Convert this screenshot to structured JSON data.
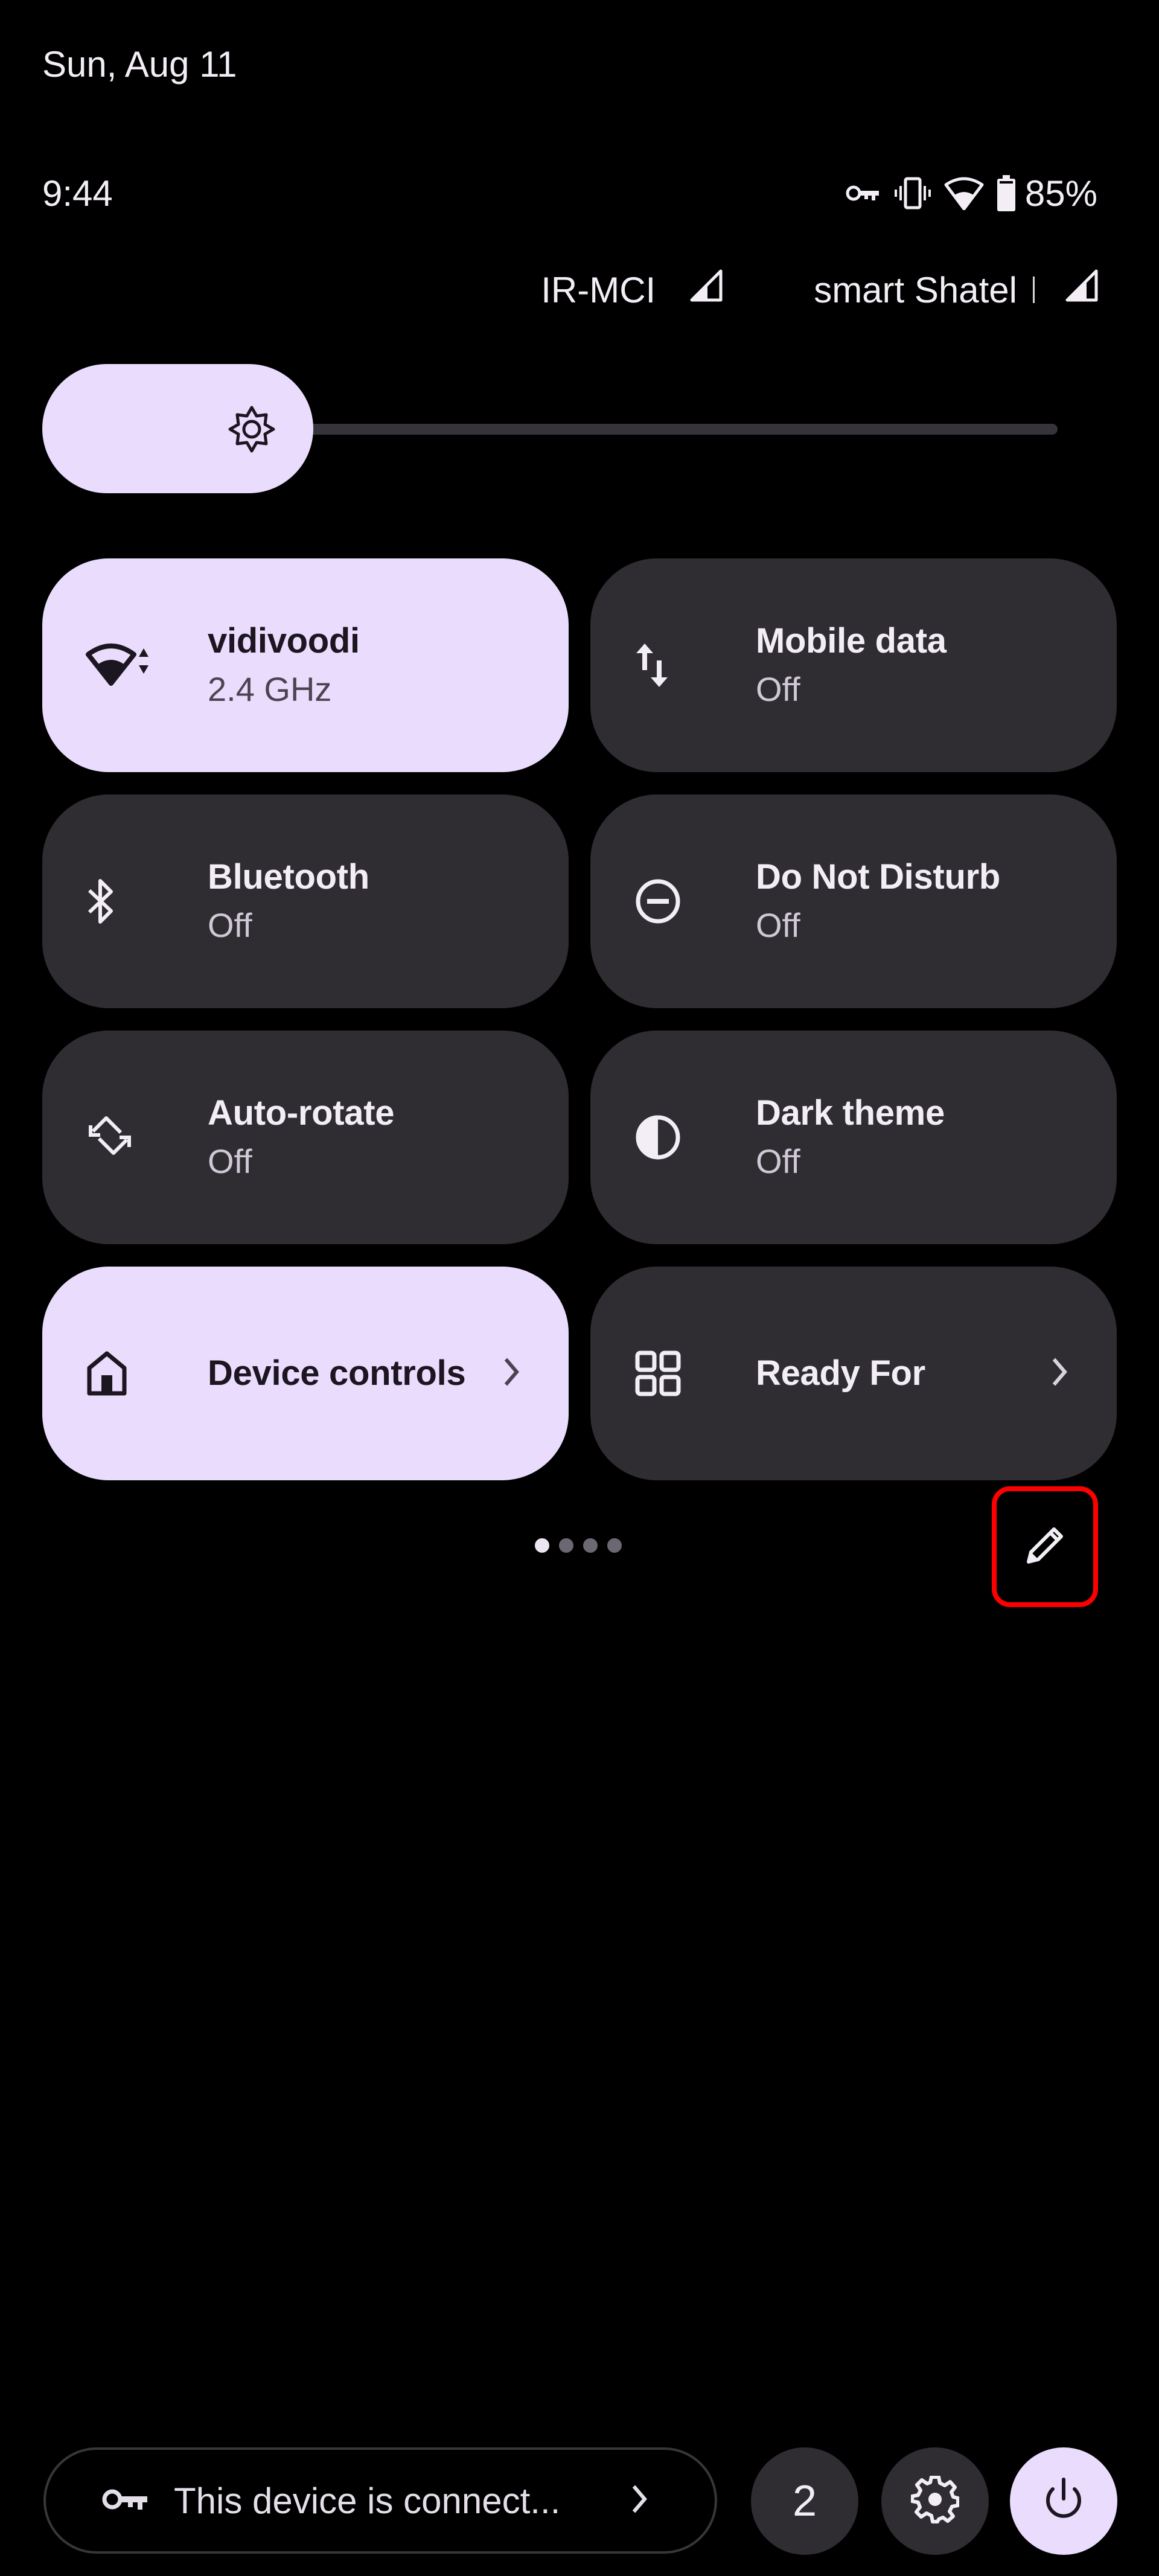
{
  "header": {
    "date": "Sun, Aug 11",
    "time": "9:44",
    "status_icons": [
      "vpn-key-icon",
      "vibrate-icon",
      "wifi-icon",
      "battery-icon"
    ],
    "battery_percent": "85%"
  },
  "carriers": [
    {
      "name": "IR-MCI",
      "signal_icon": "cell-signal-icon"
    },
    {
      "name": "smart Shatel",
      "signal_icon": "cell-signal-icon"
    }
  ],
  "brightness": {
    "icon": "brightness-icon",
    "level": 0.16
  },
  "tiles": [
    {
      "label": "vidivoodi",
      "sub": "2.4 GHz",
      "icon": "wifi-icon",
      "state": "on"
    },
    {
      "label": "Mobile data",
      "sub": "Off",
      "icon": "mobile-data-icon",
      "state": "off"
    },
    {
      "label": "Bluetooth",
      "sub": "Off",
      "icon": "bluetooth-icon",
      "state": "off"
    },
    {
      "label": "Do Not Disturb",
      "sub": "Off",
      "icon": "do-not-disturb-icon",
      "state": "off"
    },
    {
      "label": "Auto-rotate",
      "sub": "Off",
      "icon": "auto-rotate-icon",
      "state": "off"
    },
    {
      "label": "Dark theme",
      "sub": "Off",
      "icon": "dark-theme-icon",
      "state": "off"
    },
    {
      "label": "Device controls",
      "icon": "home-icon",
      "state": "on",
      "chevron": true
    },
    {
      "label": "Ready For",
      "icon": "grid-icon",
      "state": "off",
      "chevron": true
    }
  ],
  "pager": {
    "pages": 4,
    "current": 1
  },
  "edit_button": {
    "icon": "pencil-icon",
    "highlight_color": "#ff0000"
  },
  "footer": {
    "security_text": "This device is connect...",
    "users_count": "2",
    "settings_icon": "gear-icon",
    "power_icon": "power-icon"
  },
  "colors": {
    "accent": "#eadcfd",
    "tile_off": "#2f2d32",
    "background": "#000000"
  }
}
